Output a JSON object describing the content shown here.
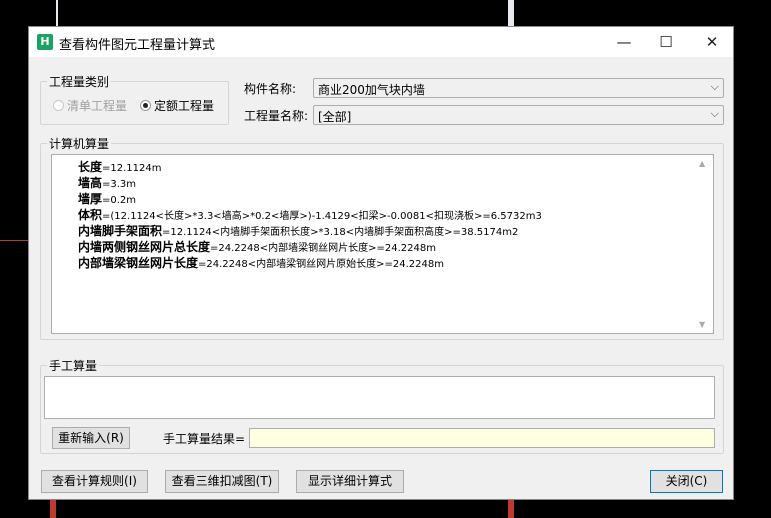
{
  "window": {
    "title": "查看构件图元工程量计算式",
    "minimize": "—",
    "maximize": "☐",
    "close": "✕"
  },
  "qty_type": {
    "legend": "工程量类别",
    "option_list": "清单工程量",
    "option_quota": "定额工程量",
    "selected": "定额工程量"
  },
  "component": {
    "label": "构件名称:",
    "value": "商业200加气块内墙"
  },
  "qty_name": {
    "label": "工程量名称:",
    "value": "[全部]"
  },
  "computer_calc": {
    "legend": "计算机算量",
    "lines": [
      {
        "name": "长度",
        "expr": "=12.1124m"
      },
      {
        "name": "墙高",
        "expr": "=3.3m"
      },
      {
        "name": "墙厚",
        "expr": "=0.2m"
      },
      {
        "name": "体积",
        "expr": "=(12.1124<长度>*3.3<墙高>*0.2<墙厚>)-1.4129<扣梁>-0.0081<扣现浇板>=6.5732m3"
      },
      {
        "name": "内墙脚手架面积",
        "expr": "=12.1124<内墙脚手架面积长度>*3.18<内墙脚手架面积高度>=38.5174m2"
      },
      {
        "name": "内墙两侧钢丝网片总长度",
        "expr": "=24.2248<内部墙梁钢丝网片长度>=24.2248m"
      },
      {
        "name": "内部墙梁钢丝网片长度",
        "expr": "=24.2248<内部墙梁钢丝网片原始长度>=24.2248m"
      }
    ]
  },
  "manual_calc": {
    "legend": "手工算量",
    "reinput_button": "重新输入(R)",
    "result_label": "手工算量结果=",
    "result_value": ""
  },
  "footer": {
    "view_rules": "查看计算规则(I)",
    "view_3d": "查看三维扣减图(T)",
    "show_detail": "显示详细计算式",
    "close": "关闭(C)"
  },
  "colors": {
    "app_icon": "#1aa260",
    "result_bg": "#ffffe1",
    "primary_border": "#0078d7"
  }
}
